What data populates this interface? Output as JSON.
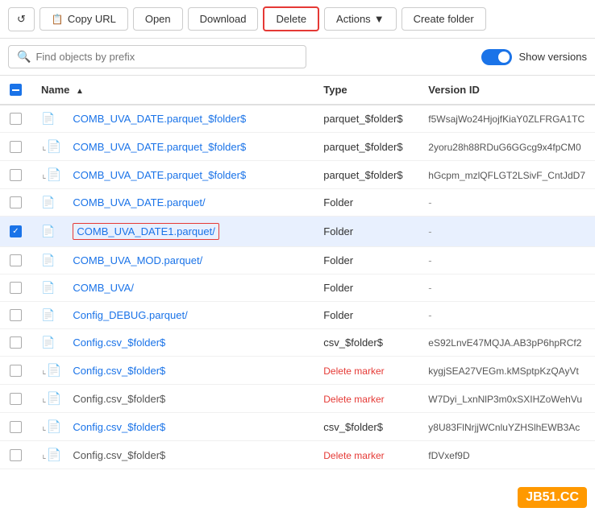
{
  "toolbar": {
    "refresh_label": "↺",
    "copy_url_label": "Copy URL",
    "open_label": "Open",
    "download_label": "Download",
    "delete_label": "Delete",
    "actions_label": "Actions",
    "create_folder_label": "Create folder"
  },
  "search": {
    "placeholder": "Find objects by prefix"
  },
  "show_versions": {
    "label": "Show versions"
  },
  "table": {
    "headers": {
      "name": "Name",
      "type": "Type",
      "version_id": "Version ID"
    },
    "rows": [
      {
        "id": 1,
        "name": "COMB_UVA_DATE.parquet_$folder$",
        "type": "parquet_$folder$",
        "version_id": "f5WsajWo24HjojfKiaY0ZLFRGA1TC",
        "selected": false,
        "versioned": false,
        "is_link": true,
        "delete_marker": false
      },
      {
        "id": 2,
        "name": "COMB_UVA_DATE.parquet_$folder$",
        "type": "parquet_$folder$",
        "version_id": "2yoru28h88RDuG6GGcg9x4fpCM0",
        "selected": false,
        "versioned": true,
        "is_link": true,
        "delete_marker": false
      },
      {
        "id": 3,
        "name": "COMB_UVA_DATE.parquet_$folder$",
        "type": "parquet_$folder$",
        "version_id": "hGcpm_mzlQFLGT2LSivF_CntJdD7",
        "selected": false,
        "versioned": true,
        "is_link": true,
        "delete_marker": false
      },
      {
        "id": 4,
        "name": "COMB_UVA_DATE.parquet/",
        "type": "Folder",
        "version_id": "-",
        "selected": false,
        "versioned": false,
        "is_link": true,
        "delete_marker": false
      },
      {
        "id": 5,
        "name": "COMB_UVA_DATE1.parquet/",
        "type": "Folder",
        "version_id": "-",
        "selected": true,
        "versioned": false,
        "is_link": true,
        "delete_marker": false
      },
      {
        "id": 6,
        "name": "COMB_UVA_MOD.parquet/",
        "type": "Folder",
        "version_id": "-",
        "selected": false,
        "versioned": false,
        "is_link": true,
        "delete_marker": false
      },
      {
        "id": 7,
        "name": "COMB_UVA/",
        "type": "Folder",
        "version_id": "-",
        "selected": false,
        "versioned": false,
        "is_link": true,
        "delete_marker": false
      },
      {
        "id": 8,
        "name": "Config_DEBUG.parquet/",
        "type": "Folder",
        "version_id": "-",
        "selected": false,
        "versioned": false,
        "is_link": true,
        "delete_marker": false
      },
      {
        "id": 9,
        "name": "Config.csv_$folder$",
        "type": "csv_$folder$",
        "version_id": "eS92LnvE47MQJA.AB3pP6hpRCf2",
        "selected": false,
        "versioned": false,
        "is_link": true,
        "delete_marker": false
      },
      {
        "id": 10,
        "name": "Config.csv_$folder$",
        "type": "Delete marker",
        "version_id": "kygjSEA27VEGm.kMSptpKzQAyVt",
        "selected": false,
        "versioned": true,
        "is_link": true,
        "delete_marker": true
      },
      {
        "id": 11,
        "name": "Config.csv_$folder$",
        "type": "Delete marker",
        "version_id": "W7Dyi_LxnNlP3m0xSXIHZoWehVu",
        "selected": false,
        "versioned": true,
        "is_link": false,
        "delete_marker": true
      },
      {
        "id": 12,
        "name": "Config.csv_$folder$",
        "type": "csv_$folder$",
        "version_id": "y8U83FlNrjjWCnluYZHSlhEWB3Ac",
        "selected": false,
        "versioned": true,
        "is_link": true,
        "delete_marker": false
      },
      {
        "id": 13,
        "name": "Config.csv_$folder$",
        "type": "Delete marker",
        "version_id": "fDVxef9D",
        "selected": false,
        "versioned": true,
        "is_link": false,
        "delete_marker": true
      }
    ]
  },
  "watermark": "JB51.CC"
}
